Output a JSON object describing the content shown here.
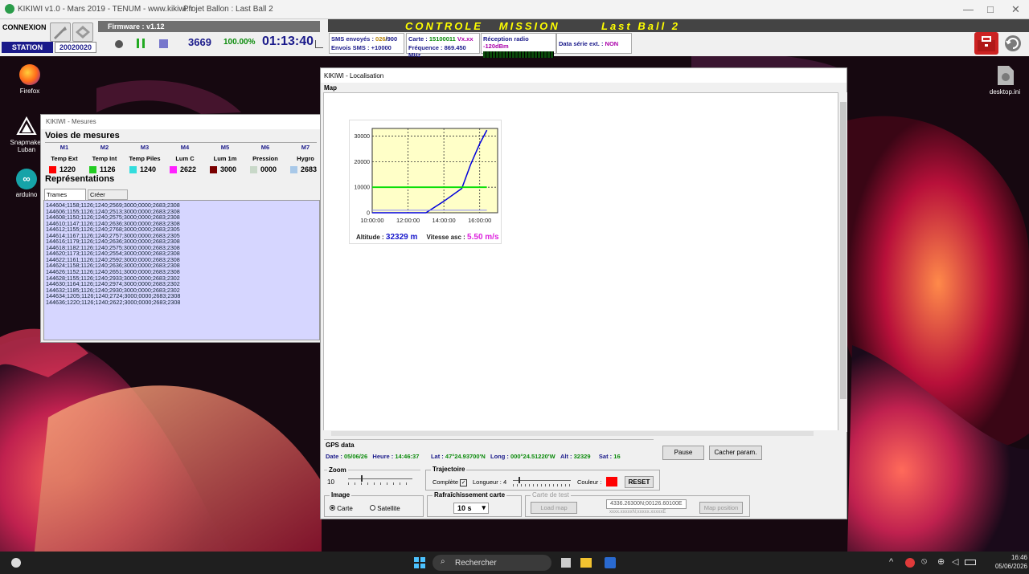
{
  "app": {
    "title": "KIKIWI v1.0 - Mars 2019 - TENUM - www.kikiwi.fr",
    "project": "Projet Ballon : Last Ball 2",
    "win_min": "—",
    "win_max": "□",
    "win_close": "✕"
  },
  "toolbar": {
    "connexion": "CONNEXION",
    "station": "STATION",
    "station_id": "20020020",
    "firmware": "Firmware : v1.12",
    "counter": "3669",
    "percent": "100.00%",
    "time": "01:13:40",
    "mission_title": "CONTROLE   MISSION",
    "mission_name": "Last Ball 2",
    "sms_sent_label": "SMS envoyés :",
    "sms_sent_value": "026",
    "sms_sent_max": "900",
    "sms_sends_label": "Envois SMS :",
    "sms_sends_value": "+10000",
    "carte_label": "Carte :",
    "carte_value": "15100011",
    "carte_version": "Vx.xx",
    "freq_label": "Fréquence :",
    "freq_value": "869.450 MHz",
    "radio_label": "Réception radio",
    "radio_value": "-120dBm",
    "serial_label": "Data série ext. :",
    "serial_value": "NON"
  },
  "desktop": {
    "icons": [
      {
        "label": "Firefox"
      },
      {
        "label": "Snapmaker Luban"
      },
      {
        "label": "arduino"
      },
      {
        "label": "desktop.ini"
      }
    ]
  },
  "mesures": {
    "title": "KIKIWI - Mesures",
    "voies_label": "Voies de mesures",
    "channels": [
      {
        "id": "M1",
        "name": "Temp Ext",
        "value": "1220",
        "color": "#ff0000"
      },
      {
        "id": "M2",
        "name": "Temp Int",
        "value": "1126",
        "color": "#22cc22"
      },
      {
        "id": "M3",
        "name": "Temp Piles",
        "value": "1240",
        "color": "#33dddd"
      },
      {
        "id": "M4",
        "name": "Lum C",
        "value": "2622",
        "color": "#ff22ff"
      },
      {
        "id": "M5",
        "name": "Lum 1m",
        "value": "3000",
        "color": "#7a0000"
      },
      {
        "id": "M6",
        "name": "Pression",
        "value": "0000",
        "color": "#c8d8c8"
      },
      {
        "id": "M7",
        "name": "Hygro",
        "value": "2683",
        "color": "#a8c8e8"
      }
    ],
    "representations_label": "Représentations",
    "tabs": [
      "Trames brutes",
      "Créer graphe"
    ],
    "trames": [
      "144604;1158;1126;1240;2569;3000;0000;2683;2308",
      "144606;1155;1126;1240;2513;3000;0000;2683;2308",
      "144608;1150;1126;1240;2575;3000;0000;2683;2308",
      "144610;1147;1126;1240;2636;3000;0000;2683;2308",
      "144612;1155;1126;1240;2768;3000;0000;2683;2305",
      "144614;1167;1126;1240;2757;3000;0000;2683;2305",
      "144616;1179;1126;1240;2636;3000;0000;2683;2308",
      "144618;1182;1126;1240;2575;3000;0000;2683;2308",
      "144620;1173;1126;1240;2554;3000;0000;2683;2308",
      "144622;1161;1126;1240;2592;3000;0000;2683;2308",
      "144624;1158;1126;1240;2636;3000;0000;2683;2308",
      "144626;1152;1126;1240;2651;3000;0000;2683;2308",
      "144628;1155;1126;1240;2933;3000;0000;2683;2302",
      "144630;1164;1126;1240;2974;3000;0000;2683;2302",
      "144632;1185;1126;1240;2930;3000;0000;2683;2302",
      "144634;1205;1126;1240;2724;3000;0000;2683;2308",
      "144636;1220;1126;1240;2622;3000;0000;2683;2308"
    ]
  },
  "localisation": {
    "title": "KIKIWI - Localisation",
    "map_label": "Map",
    "altitude_label": "Altitude :",
    "altitude_value": "32329 m",
    "vitesse_label": "Vitesse asc :",
    "vitesse_value": "5.50 m/s",
    "gps_label": "GPS data",
    "date_label": "Date :",
    "date_value": "05/06/26",
    "heure_label": "Heure :",
    "heure_value": "14:46:37",
    "lat_label": "Lat :",
    "lat_value": "47°24.93700'N",
    "long_label": "Long :",
    "long_value": "000°24.51220'W",
    "alt_label": "Alt :",
    "alt_value": "32329",
    "sat_label": "Sat :",
    "sat_value": "16",
    "pause": "Pause",
    "cacher": "Cacher param.",
    "zoom_label": "Zoom",
    "zoom_value": "10",
    "zoom_level": 0.2,
    "trajectoire_label": "Trajectoire",
    "complete_label": "Complète",
    "longueur_label": "Longueur :",
    "longueur_value": "4",
    "longueur_level": 0.1,
    "couleur_label": "Couleur :",
    "couleur_value": "#ff0000",
    "reset": "RESET",
    "image_label": "Image",
    "carte_radio": "Carte",
    "satellite_radio": "Satellite",
    "refresh_label": "Rafraîchissement carte",
    "refresh_value": "10 s",
    "carte_test_label": "Carte de test",
    "load_map": "Load map",
    "coord_value": "4336.26300N;00126.60100E",
    "coord_hint": "xxxx.xxxxxN;xxxxx.xxxxxE",
    "map_position": "Map position"
  },
  "chart_data": {
    "type": "line",
    "xlabels": [
      "10:00:00",
      "12:00:00",
      "14:00:00",
      "16:00:00"
    ],
    "ytick_labels": [
      "0",
      "10000",
      "20000",
      "30000"
    ],
    "ylim": [
      0,
      33000
    ],
    "xlim_hours": [
      10,
      17
    ],
    "series": [
      {
        "points": [
          [
            10.0,
            0
          ],
          [
            11.0,
            0
          ],
          [
            12.0,
            0
          ],
          [
            13.0,
            0
          ],
          [
            14.0,
            4500
          ],
          [
            15.0,
            9500
          ],
          [
            15.5,
            19000
          ],
          [
            16.0,
            27000
          ],
          [
            16.4,
            32329
          ]
        ],
        "color": "#0000dd"
      },
      {
        "points": [
          [
            10.0,
            10000
          ],
          [
            16.4,
            10000
          ]
        ],
        "color": "#00dd00"
      },
      {
        "points": [
          [
            10.0,
            1000
          ],
          [
            16.4,
            1000
          ]
        ],
        "color": "#8888ff"
      }
    ]
  },
  "taskbar": {
    "search_placeholder": "Rechercher",
    "time": "16:46",
    "date": "05/06/2026"
  }
}
